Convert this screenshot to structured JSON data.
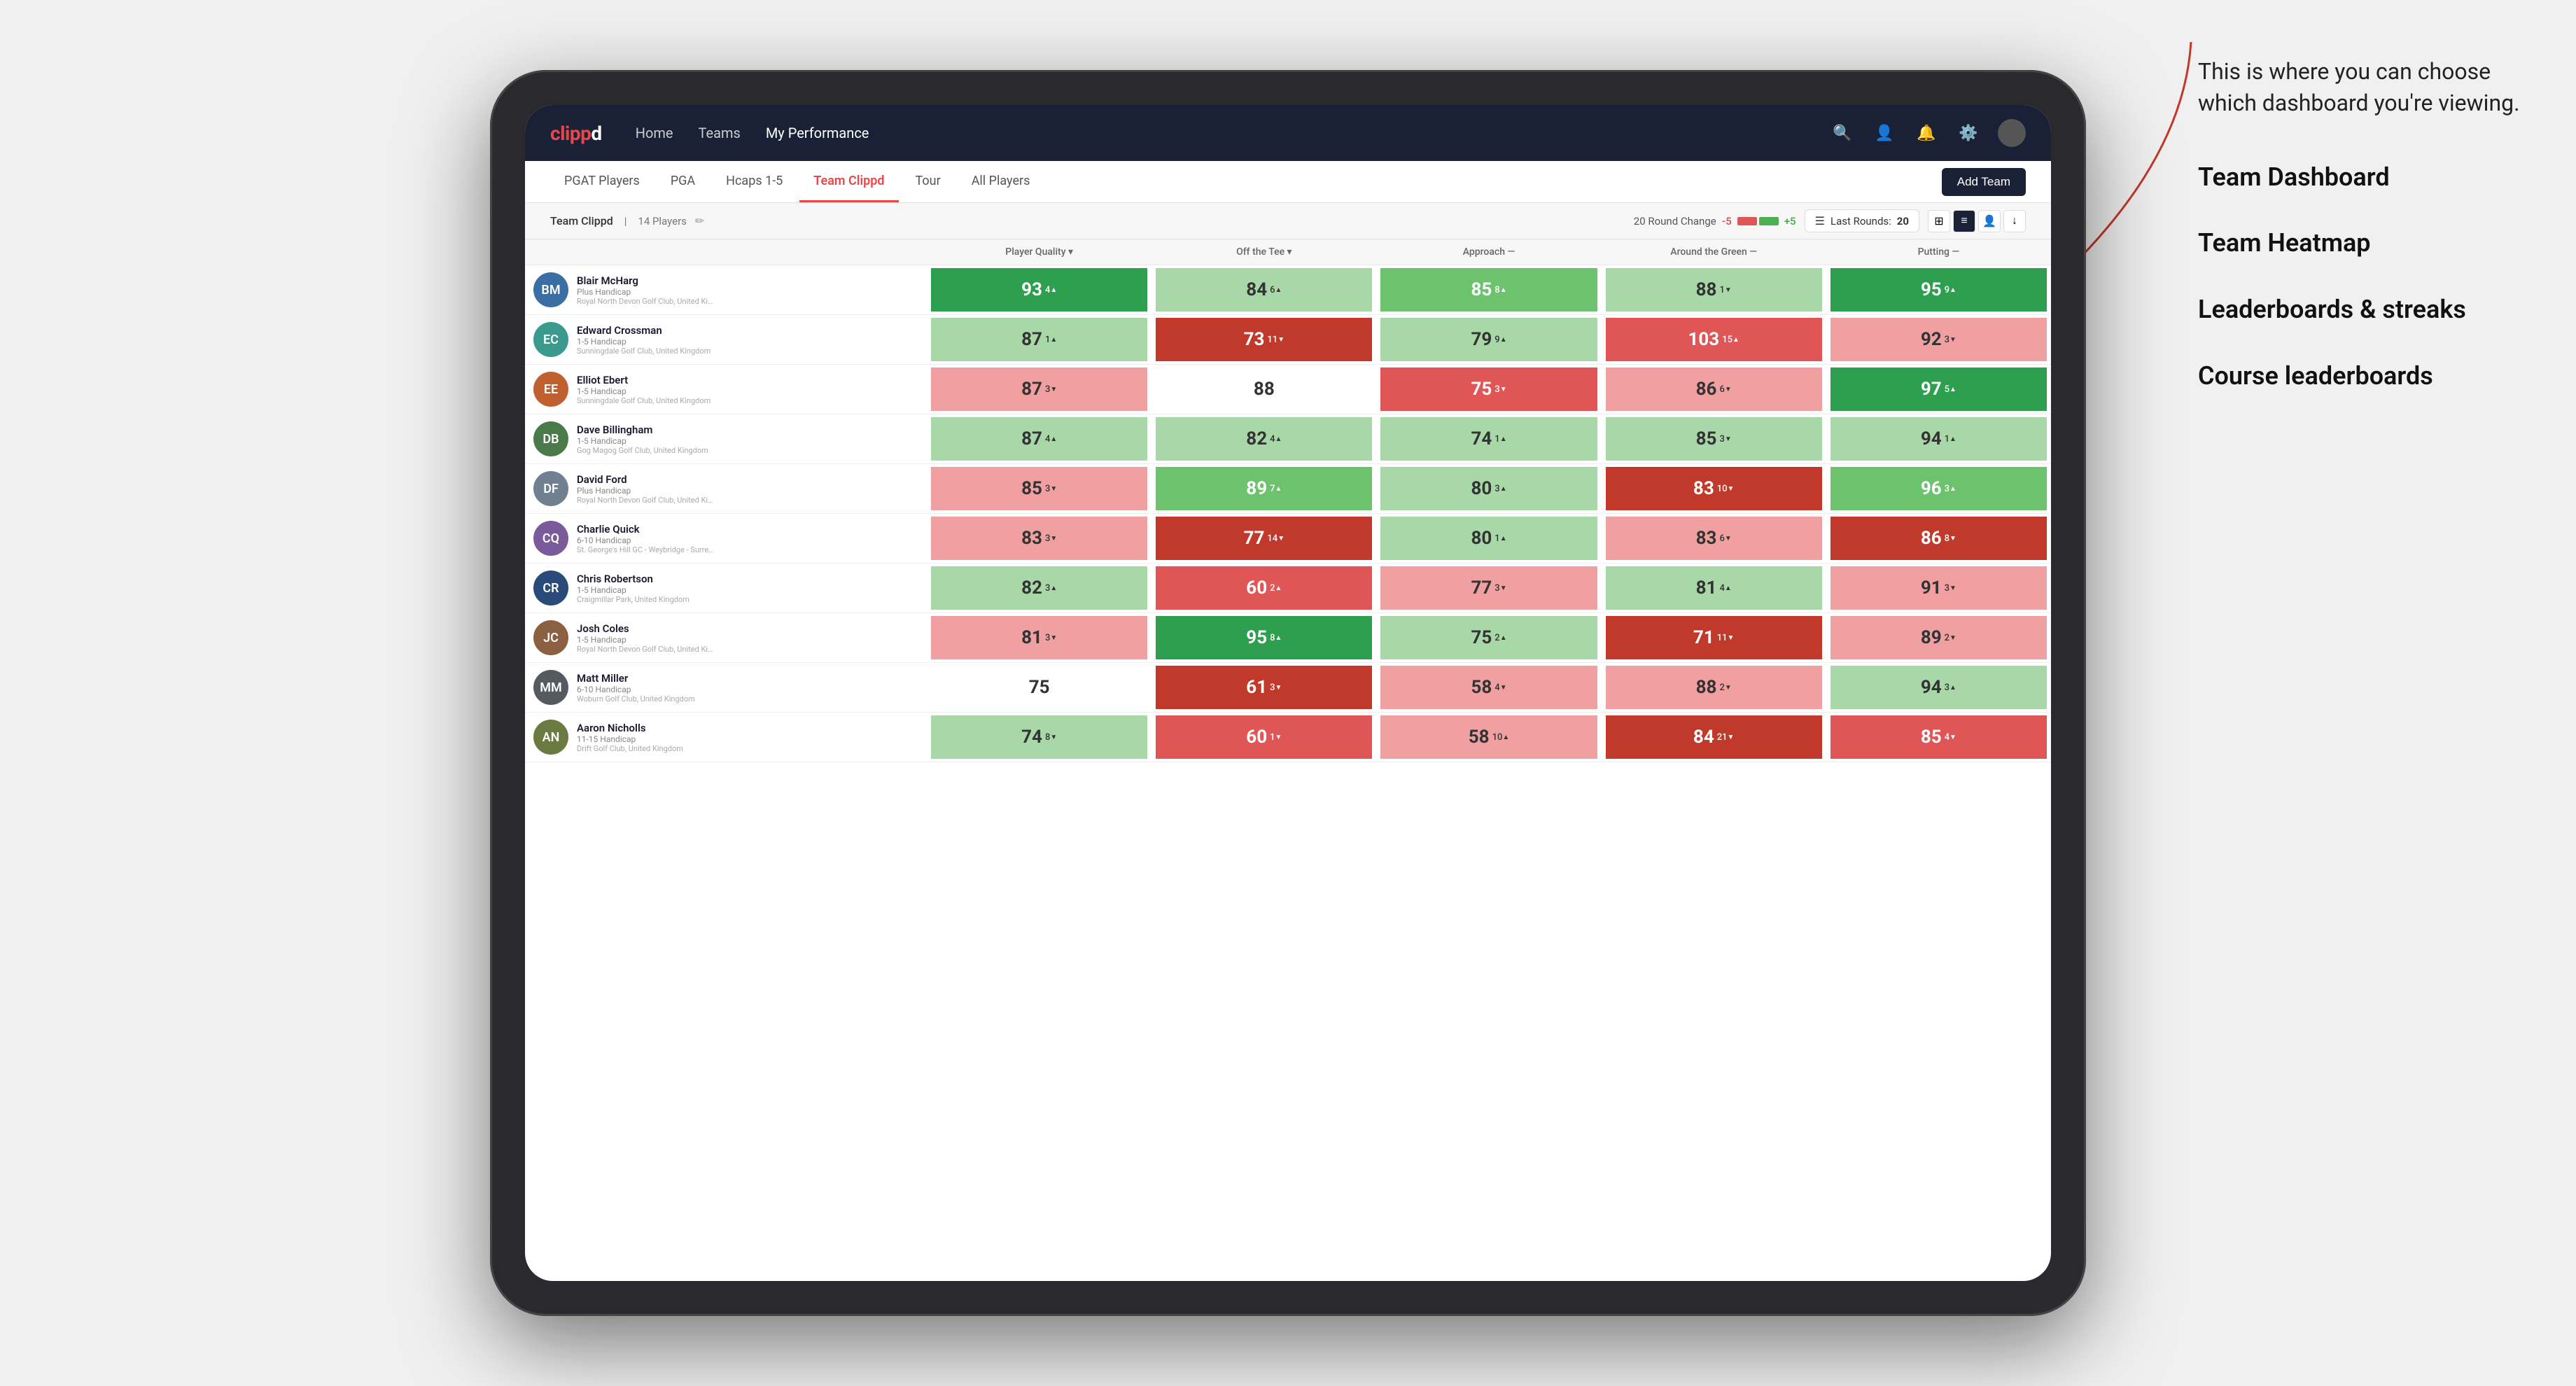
{
  "annotation": {
    "intro_text": "This is where you can choose which dashboard you're viewing.",
    "items": [
      {
        "label": "Team Dashboard"
      },
      {
        "label": "Team Heatmap"
      },
      {
        "label": "Leaderboards & streaks"
      },
      {
        "label": "Course leaderboards"
      }
    ]
  },
  "navbar": {
    "logo": "clippd",
    "links": [
      {
        "label": "Home",
        "active": false
      },
      {
        "label": "Teams",
        "active": false
      },
      {
        "label": "My Performance",
        "active": false
      }
    ],
    "add_team_label": "Add Team"
  },
  "subnav": {
    "tabs": [
      {
        "label": "PGAT Players",
        "active": false
      },
      {
        "label": "PGA",
        "active": false
      },
      {
        "label": "Hcaps 1-5",
        "active": false
      },
      {
        "label": "Team Clippd",
        "active": true
      },
      {
        "label": "Tour",
        "active": false
      },
      {
        "label": "All Players",
        "active": false
      }
    ]
  },
  "team_header": {
    "team_name": "Team Clippd",
    "player_count": "14 Players",
    "round_change_label": "20 Round Change",
    "minus_val": "-5",
    "plus_val": "+5",
    "last_rounds_label": "Last Rounds:",
    "last_rounds_val": "20"
  },
  "table": {
    "columns": [
      {
        "label": "Player Quality ▾",
        "key": "quality"
      },
      {
        "label": "Off the Tee ▾",
        "key": "off_tee"
      },
      {
        "label": "Approach —",
        "key": "approach"
      },
      {
        "label": "Around the Green —",
        "key": "around_green"
      },
      {
        "label": "Putting —",
        "key": "putting"
      }
    ],
    "players": [
      {
        "name": "Blair McHarg",
        "handicap": "Plus Handicap",
        "club": "Royal North Devon Golf Club, United Kingdom",
        "initials": "BM",
        "avatar_color": "av-blue",
        "quality": {
          "val": "93",
          "change": "4",
          "trend": "up",
          "bg": "bg-green-dark"
        },
        "off_tee": {
          "val": "84",
          "change": "6",
          "trend": "up",
          "bg": "bg-green-light"
        },
        "approach": {
          "val": "85",
          "change": "8",
          "trend": "up",
          "bg": "bg-green-mid"
        },
        "around_green": {
          "val": "88",
          "change": "1",
          "trend": "down",
          "bg": "bg-green-light"
        },
        "putting": {
          "val": "95",
          "change": "9",
          "trend": "up",
          "bg": "bg-green-dark"
        }
      },
      {
        "name": "Edward Crossman",
        "handicap": "1-5 Handicap",
        "club": "Sunningdale Golf Club, United Kingdom",
        "initials": "EC",
        "avatar_color": "av-teal",
        "quality": {
          "val": "87",
          "change": "1",
          "trend": "up",
          "bg": "bg-green-light"
        },
        "off_tee": {
          "val": "73",
          "change": "11",
          "trend": "down",
          "bg": "bg-red-dark"
        },
        "approach": {
          "val": "79",
          "change": "9",
          "trend": "up",
          "bg": "bg-green-light"
        },
        "around_green": {
          "val": "103",
          "change": "15",
          "trend": "up",
          "bg": "bg-red-mid"
        },
        "putting": {
          "val": "92",
          "change": "3",
          "trend": "down",
          "bg": "bg-red-light"
        }
      },
      {
        "name": "Elliot Ebert",
        "handicap": "1-5 Handicap",
        "club": "Sunningdale Golf Club, United Kingdom",
        "initials": "EE",
        "avatar_color": "av-orange",
        "quality": {
          "val": "87",
          "change": "3",
          "trend": "down",
          "bg": "bg-red-light"
        },
        "off_tee": {
          "val": "88",
          "change": "",
          "trend": "",
          "bg": "bg-white"
        },
        "approach": {
          "val": "75",
          "change": "3",
          "trend": "down",
          "bg": "bg-red-mid"
        },
        "around_green": {
          "val": "86",
          "change": "6",
          "trend": "down",
          "bg": "bg-red-light"
        },
        "putting": {
          "val": "97",
          "change": "5",
          "trend": "up",
          "bg": "bg-green-dark"
        }
      },
      {
        "name": "Dave Billingham",
        "handicap": "1-5 Handicap",
        "club": "Gog Magog Golf Club, United Kingdom",
        "initials": "DB",
        "avatar_color": "av-green",
        "quality": {
          "val": "87",
          "change": "4",
          "trend": "up",
          "bg": "bg-green-light"
        },
        "off_tee": {
          "val": "82",
          "change": "4",
          "trend": "up",
          "bg": "bg-green-light"
        },
        "approach": {
          "val": "74",
          "change": "1",
          "trend": "up",
          "bg": "bg-green-light"
        },
        "around_green": {
          "val": "85",
          "change": "3",
          "trend": "down",
          "bg": "bg-green-light"
        },
        "putting": {
          "val": "94",
          "change": "1",
          "trend": "up",
          "bg": "bg-green-light"
        }
      },
      {
        "name": "David Ford",
        "handicap": "Plus Handicap",
        "club": "Royal North Devon Golf Club, United Kingdom",
        "initials": "DF",
        "avatar_color": "av-gray",
        "quality": {
          "val": "85",
          "change": "3",
          "trend": "down",
          "bg": "bg-red-light"
        },
        "off_tee": {
          "val": "89",
          "change": "7",
          "trend": "up",
          "bg": "bg-green-mid"
        },
        "approach": {
          "val": "80",
          "change": "3",
          "trend": "up",
          "bg": "bg-green-light"
        },
        "around_green": {
          "val": "83",
          "change": "10",
          "trend": "down",
          "bg": "bg-red-dark"
        },
        "putting": {
          "val": "96",
          "change": "3",
          "trend": "up",
          "bg": "bg-green-mid"
        }
      },
      {
        "name": "Charlie Quick",
        "handicap": "6-10 Handicap",
        "club": "St. George's Hill GC - Weybridge - Surrey, Uni...",
        "initials": "CQ",
        "avatar_color": "av-purple",
        "quality": {
          "val": "83",
          "change": "3",
          "trend": "down",
          "bg": "bg-red-light"
        },
        "off_tee": {
          "val": "77",
          "change": "14",
          "trend": "down",
          "bg": "bg-red-dark"
        },
        "approach": {
          "val": "80",
          "change": "1",
          "trend": "up",
          "bg": "bg-green-light"
        },
        "around_green": {
          "val": "83",
          "change": "6",
          "trend": "down",
          "bg": "bg-red-light"
        },
        "putting": {
          "val": "86",
          "change": "8",
          "trend": "down",
          "bg": "bg-red-dark"
        }
      },
      {
        "name": "Chris Robertson",
        "handicap": "1-5 Handicap",
        "club": "Craigmillar Park, United Kingdom",
        "initials": "CR",
        "avatar_color": "av-navy",
        "quality": {
          "val": "82",
          "change": "3",
          "trend": "up",
          "bg": "bg-green-light"
        },
        "off_tee": {
          "val": "60",
          "change": "2",
          "trend": "up",
          "bg": "bg-red-mid"
        },
        "approach": {
          "val": "77",
          "change": "3",
          "trend": "down",
          "bg": "bg-red-light"
        },
        "around_green": {
          "val": "81",
          "change": "4",
          "trend": "up",
          "bg": "bg-green-light"
        },
        "putting": {
          "val": "91",
          "change": "3",
          "trend": "down",
          "bg": "bg-red-light"
        }
      },
      {
        "name": "Josh Coles",
        "handicap": "1-5 Handicap",
        "club": "Royal North Devon Golf Club, United Kingdom",
        "initials": "JC",
        "avatar_color": "av-brown",
        "quality": {
          "val": "81",
          "change": "3",
          "trend": "down",
          "bg": "bg-red-light"
        },
        "off_tee": {
          "val": "95",
          "change": "8",
          "trend": "up",
          "bg": "bg-green-dark"
        },
        "approach": {
          "val": "75",
          "change": "2",
          "trend": "up",
          "bg": "bg-green-light"
        },
        "around_green": {
          "val": "71",
          "change": "11",
          "trend": "down",
          "bg": "bg-red-dark"
        },
        "putting": {
          "val": "89",
          "change": "2",
          "trend": "down",
          "bg": "bg-red-light"
        }
      },
      {
        "name": "Matt Miller",
        "handicap": "6-10 Handicap",
        "club": "Woburn Golf Club, United Kingdom",
        "initials": "MM",
        "avatar_color": "av-darkgray",
        "quality": {
          "val": "75",
          "change": "",
          "trend": "",
          "bg": "bg-white"
        },
        "off_tee": {
          "val": "61",
          "change": "3",
          "trend": "down",
          "bg": "bg-red-dark"
        },
        "approach": {
          "val": "58",
          "change": "4",
          "trend": "down",
          "bg": "bg-red-light"
        },
        "around_green": {
          "val": "88",
          "change": "2",
          "trend": "down",
          "bg": "bg-red-light"
        },
        "putting": {
          "val": "94",
          "change": "3",
          "trend": "up",
          "bg": "bg-green-light"
        }
      },
      {
        "name": "Aaron Nicholls",
        "handicap": "11-15 Handicap",
        "club": "Drift Golf Club, United Kingdom",
        "initials": "AN",
        "avatar_color": "av-olive",
        "quality": {
          "val": "74",
          "change": "8",
          "trend": "down",
          "bg": "bg-green-light"
        },
        "off_tee": {
          "val": "60",
          "change": "1",
          "trend": "down",
          "bg": "bg-red-mid"
        },
        "approach": {
          "val": "58",
          "change": "10",
          "trend": "up",
          "bg": "bg-red-light"
        },
        "around_green": {
          "val": "84",
          "change": "21",
          "trend": "down",
          "bg": "bg-red-dark"
        },
        "putting": {
          "val": "85",
          "change": "4",
          "trend": "down",
          "bg": "bg-red-mid"
        }
      }
    ]
  }
}
